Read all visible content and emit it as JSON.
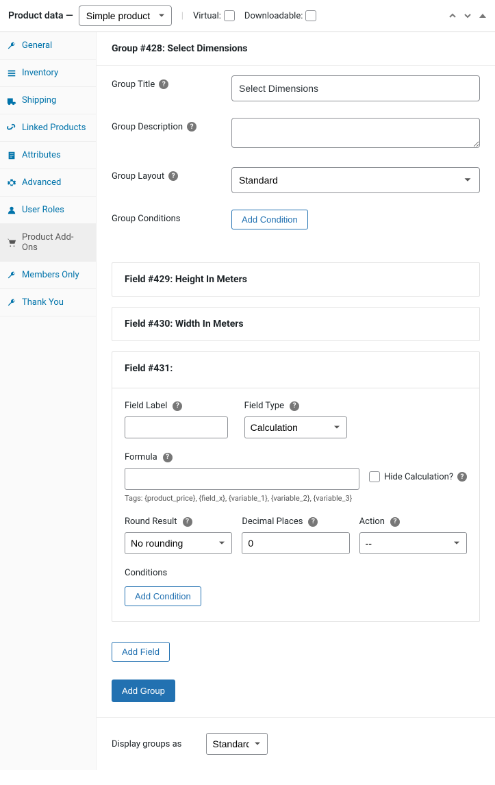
{
  "header": {
    "title": "Product data —",
    "product_type": "Simple product",
    "virtual_label": "Virtual:",
    "downloadable_label": "Downloadable:"
  },
  "sidebar": {
    "items": [
      {
        "label": "General",
        "icon": "wrench"
      },
      {
        "label": "Inventory",
        "icon": "list"
      },
      {
        "label": "Shipping",
        "icon": "truck"
      },
      {
        "label": "Linked Products",
        "icon": "link"
      },
      {
        "label": "Attributes",
        "icon": "note"
      },
      {
        "label": "Advanced",
        "icon": "gear"
      },
      {
        "label": "User Roles",
        "icon": "user"
      },
      {
        "label": "Product Add-Ons",
        "icon": "cart",
        "active": true
      },
      {
        "label": "Members Only",
        "icon": "wrench"
      },
      {
        "label": "Thank You",
        "icon": "wrench"
      }
    ]
  },
  "group": {
    "header": "Group #428: Select Dimensions",
    "title_label": "Group Title",
    "title_value": "Select Dimensions",
    "desc_label": "Group Description",
    "desc_value": "",
    "layout_label": "Group Layout",
    "layout_value": "Standard",
    "conditions_label": "Group Conditions",
    "add_condition": "Add Condition"
  },
  "fields": [
    {
      "header": "Field #429: Height In Meters"
    },
    {
      "header": "Field #430: Width In Meters"
    }
  ],
  "field431": {
    "header": "Field #431:",
    "label_label": "Field Label",
    "label_value": "",
    "type_label": "Field Type",
    "type_value": "Calculation",
    "formula_label": "Formula",
    "formula_value": "",
    "hide_calc_label": "Hide Calculation?",
    "tags_hint": "Tags: {product_price}, {field_x}, {variable_1}, {variable_2}, {variable_3}",
    "round_label": "Round Result",
    "round_value": "No rounding",
    "decimal_label": "Decimal Places",
    "decimal_value": "0",
    "action_label": "Action",
    "action_value": "--",
    "conditions_label": "Conditions",
    "add_condition": "Add Condition"
  },
  "add_field": "Add Field",
  "add_group": "Add Group",
  "display_as_label": "Display groups as",
  "display_as_value": "Standard"
}
